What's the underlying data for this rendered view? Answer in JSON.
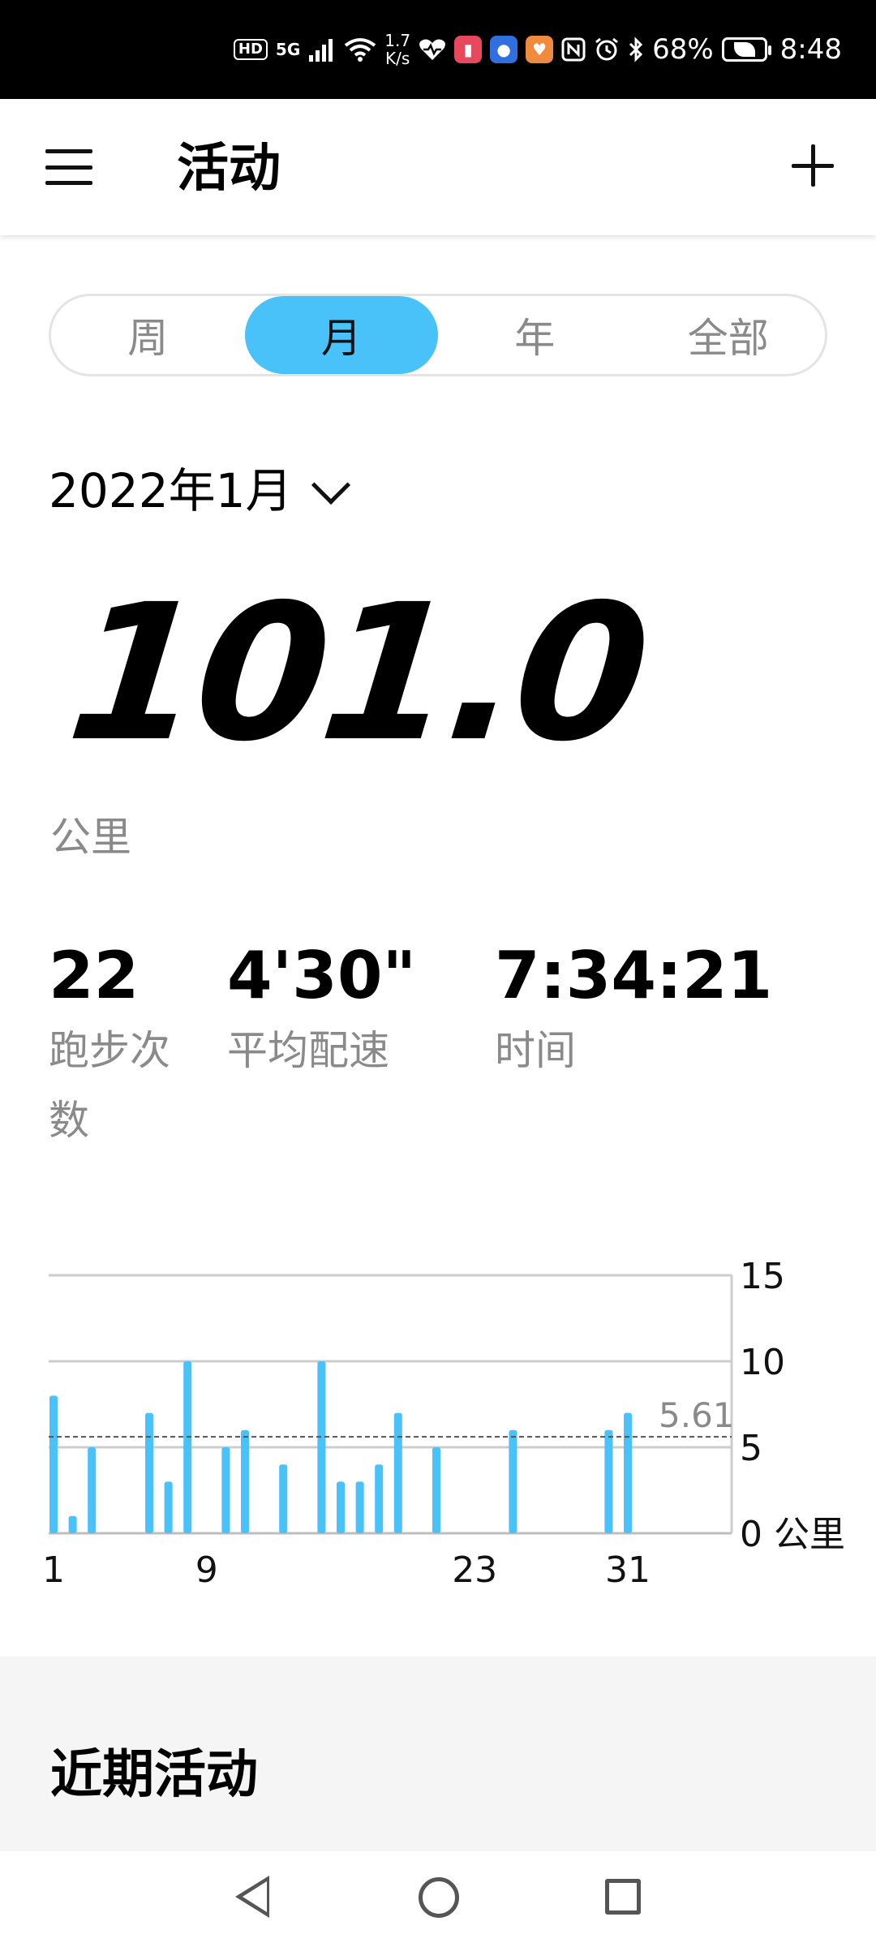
{
  "status_bar": {
    "hd": "HD",
    "network": "5G",
    "speed_top": "1.7",
    "speed_bottom": "K/s",
    "battery_percent": "68%",
    "time": "8:48"
  },
  "header": {
    "title": "活动",
    "menu_icon": "hamburger-menu-icon",
    "add_icon": "plus-icon"
  },
  "tabs": [
    {
      "label": "周",
      "active": false
    },
    {
      "label": "月",
      "active": true
    },
    {
      "label": "年",
      "active": false
    },
    {
      "label": "全部",
      "active": false
    }
  ],
  "month_selector": {
    "label": "2022年1月",
    "icon": "chevron-down-icon"
  },
  "summary": {
    "distance": "101.0",
    "unit": "公里"
  },
  "stats": [
    {
      "value": "22",
      "label": "跑步次数"
    },
    {
      "value": "4'30\"",
      "label": "平均配速"
    },
    {
      "value": "7:34:21",
      "label": "时间"
    }
  ],
  "colors": {
    "accent": "#48c2f9",
    "text_secondary": "#8a8a8a",
    "grid": "#cccccc"
  },
  "chart_data": {
    "type": "bar",
    "x": [
      1,
      2,
      3,
      6,
      7,
      8,
      10,
      11,
      13,
      15,
      16,
      17,
      18,
      19,
      21,
      25,
      30,
      31
    ],
    "values": [
      8,
      1,
      5,
      7,
      3,
      10,
      5,
      6,
      4,
      10,
      3,
      3,
      4,
      7,
      5,
      6,
      6,
      7
    ],
    "x_tick_labels": [
      "1",
      "9",
      "23",
      "31"
    ],
    "x_tick_values": [
      1,
      9,
      23,
      31
    ],
    "y_ticks": [
      0,
      5,
      10,
      15
    ],
    "y_tick_labels": [
      "0 公里",
      "5",
      "10",
      "15"
    ],
    "ylim": [
      0,
      15
    ],
    "xlim": [
      1,
      31
    ],
    "average_line": {
      "value": 5.61,
      "label": "5.61"
    },
    "grid": true,
    "y_axis_position": "right"
  },
  "recent": {
    "title": "近期活动"
  },
  "nav_bar": {
    "back_icon": "back-triangle-icon",
    "home_icon": "home-circle-icon",
    "recents_icon": "recents-square-icon"
  }
}
